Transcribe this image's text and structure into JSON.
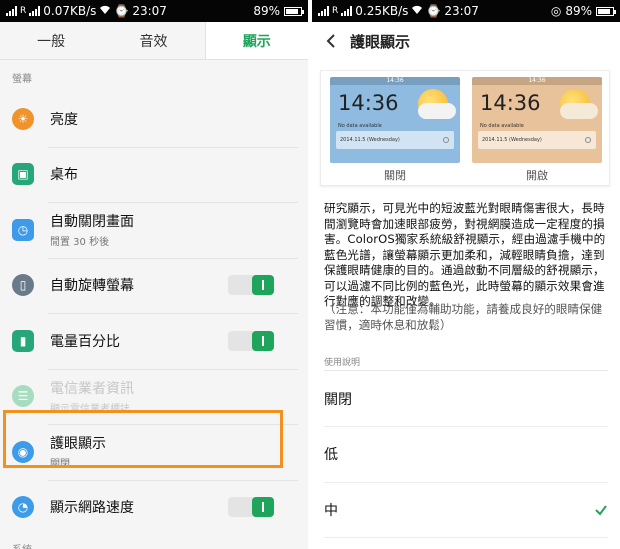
{
  "left": {
    "status": {
      "speed": "0.07KB/s",
      "time": "23:07",
      "battery": "89%",
      "battery_level": 0.89
    },
    "tabs": [
      "一般",
      "音效",
      "顯示"
    ],
    "section_title": "螢幕",
    "items": [
      {
        "title": "亮度",
        "subtitle": ""
      },
      {
        "title": "桌布",
        "subtitle": ""
      },
      {
        "title": "自動關閉畫面",
        "subtitle": "閒置 30 秒後"
      },
      {
        "title": "自動旋轉螢幕",
        "subtitle": ""
      },
      {
        "title": "電量百分比",
        "subtitle": ""
      },
      {
        "title": "電信業者資訊",
        "subtitle": "顯示電信業者標誌"
      },
      {
        "title": "護眼顯示",
        "subtitle": "關閉"
      },
      {
        "title": "顯示網路速度",
        "subtitle": ""
      }
    ],
    "bottom_section": "系統"
  },
  "right": {
    "status": {
      "speed": "0.25KB/s",
      "time": "23:07",
      "battery": "89%",
      "battery_level": 0.89
    },
    "title": "護眼顯示",
    "preview": {
      "time": "14:36",
      "status_time": "14:36",
      "no_data": "No data available",
      "date": "2014.11.5 (Wednesday)",
      "off_label": "關閉",
      "on_label": "開啟"
    },
    "description": "研究顯示，可見光中的短波藍光對眼睛傷害很大，長時間瀏覽時會加速眼部疲勞，對視網膜造成一定程度的損害。ColorOS獨家系統級舒視顯示，經由過濾手機中的藍色光譜，讓螢幕顯示更加柔和，減輕眼睛負擔，達到保護眼睛健康的目的。通過啟動不同層級的舒視顯示，可以過濾不同比例的藍色光，此時螢幕的顯示效果會進行對應的調整和改變。",
    "note": "（注意：本功能僅為輔助功能，請養成良好的眼睛保健習慣，適時休息和放鬆）",
    "usage_title": "使用說明",
    "options": [
      "關閉",
      "低",
      "中"
    ],
    "selected_option": "中"
  },
  "colors": {
    "accent": "#1fa45c",
    "highlight": "#f2911c"
  }
}
